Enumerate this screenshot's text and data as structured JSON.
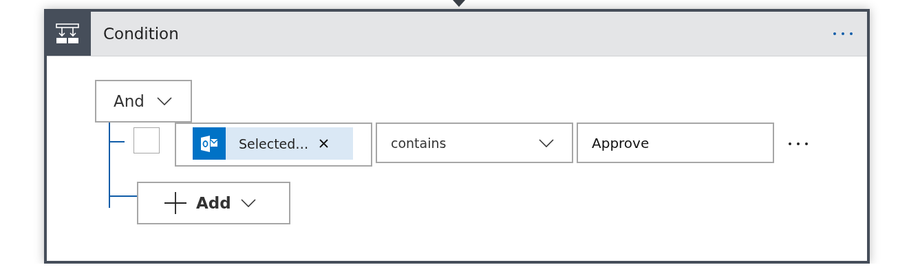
{
  "card": {
    "title": "Condition"
  },
  "group": {
    "operator": "And"
  },
  "rows": [
    {
      "checked": false,
      "token": {
        "label": "Selected…"
      },
      "operator": "contains",
      "value": "Approve"
    }
  ],
  "add_button": {
    "label": "Add"
  }
}
